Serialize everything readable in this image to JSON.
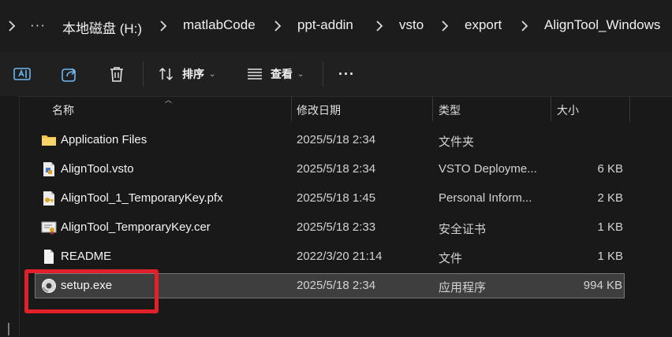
{
  "breadcrumb": {
    "overflow": "···",
    "items": [
      "本地磁盘 (H:)",
      "matlabCode",
      "ppt-addin",
      "vsto",
      "export",
      "AlignTool_Windows"
    ]
  },
  "toolbar": {
    "sort_label": "排序",
    "view_label": "查看",
    "more_label": "···"
  },
  "columns": {
    "name": "名称",
    "modified": "修改日期",
    "type": "类型",
    "size": "大小"
  },
  "files": [
    {
      "name": "Application Files",
      "modified": "2025/5/18 2:34",
      "type": "文件夹",
      "size": "",
      "icon": "folder-icon"
    },
    {
      "name": "AlignTool.vsto",
      "modified": "2025/5/18 2:34",
      "type": "VSTO Deployme...",
      "size": "6 KB",
      "icon": "vsto-file-icon"
    },
    {
      "name": "AlignTool_1_TemporaryKey.pfx",
      "modified": "2025/5/18 1:45",
      "type": "Personal Inform...",
      "size": "2 KB",
      "icon": "certificate-key-icon"
    },
    {
      "name": "AlignTool_TemporaryKey.cer",
      "modified": "2025/5/18 2:33",
      "type": "安全证书",
      "size": "1 KB",
      "icon": "certificate-icon"
    },
    {
      "name": "README",
      "modified": "2022/3/20 21:14",
      "type": "文件",
      "size": "1 KB",
      "icon": "file-icon"
    },
    {
      "name": "setup.exe",
      "modified": "2025/5/18 2:34",
      "type": "应用程序",
      "size": "994 KB",
      "icon": "setup-exe-icon",
      "selected": true
    }
  ],
  "colors": {
    "background": "#191919",
    "selection": "#3e3e3e",
    "annotation_red": "#e2202a",
    "folder_yellow": "#f4c23f"
  }
}
